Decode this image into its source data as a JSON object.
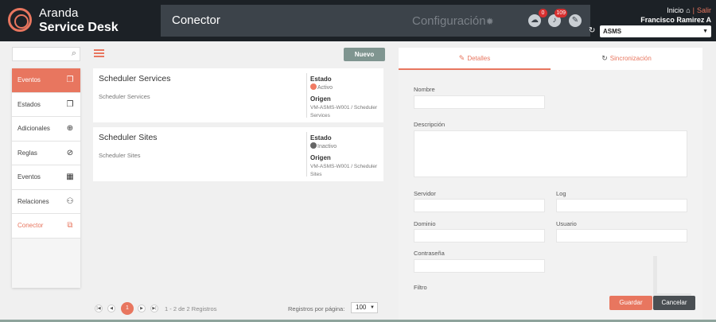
{
  "colors": {
    "accent": "#e8765f",
    "header_bg": "#1c2126",
    "active_status": "#f07a63",
    "inactive_status": "#666666",
    "new_button": "#7f9590"
  },
  "brand": {
    "line1": "Aranda",
    "line2": "Service Desk"
  },
  "header": {
    "title": "Conector",
    "section": "Configuración",
    "notifications": [
      {
        "icon": "cloud-icon",
        "count": "0"
      },
      {
        "icon": "bell-icon",
        "count": "109"
      },
      {
        "icon": "tools-icon",
        "count": ""
      }
    ],
    "home_label": "Inicio",
    "logout_label": "Salir",
    "user_name": "Francisco Ramirez A",
    "workspace": "ASMS"
  },
  "sidebar": {
    "items": [
      {
        "label": "Eventos",
        "icon": "copy-icon"
      },
      {
        "label": "Estados",
        "icon": "copy-icon"
      },
      {
        "label": "Adicionales",
        "icon": "plus-circle-icon"
      },
      {
        "label": "Reglas",
        "icon": "compass-icon"
      },
      {
        "label": "Eventos",
        "icon": "calendar-clock-icon"
      },
      {
        "label": "Relaciones",
        "icon": "network-icon"
      },
      {
        "label": "Conector",
        "icon": "connector-icon"
      }
    ]
  },
  "list": {
    "new_label": "Nuevo",
    "state_label": "Estado",
    "origin_label": "Origen",
    "items": [
      {
        "title": "Scheduler Services",
        "subtitle": "Scheduler Services",
        "status": "Activo",
        "origin": "VM-ASMS-W001 / Scheduler Services"
      },
      {
        "title": "Scheduler Sites",
        "subtitle": "Scheduler Sites",
        "status": "Inactivo",
        "origin": "VM-ASMS-W001 / Scheduler Sites"
      }
    ],
    "pagination": {
      "current_page": "1",
      "info": "1 - 2 de 2 Registros",
      "per_page_label": "Registros por página:",
      "per_page": "100"
    }
  },
  "detail": {
    "tabs": [
      {
        "label": "Detalles"
      },
      {
        "label": "Sincronización"
      }
    ],
    "fields": {
      "nombre": "Nombre",
      "descripcion": "Descripción",
      "servidor": "Servidor",
      "log": "Log",
      "dominio": "Dominio",
      "usuario": "Usuario",
      "contrasena": "Contraseña",
      "filtro": "Filtro"
    },
    "save_label": "Guardar",
    "cancel_label": "Cancelar"
  }
}
